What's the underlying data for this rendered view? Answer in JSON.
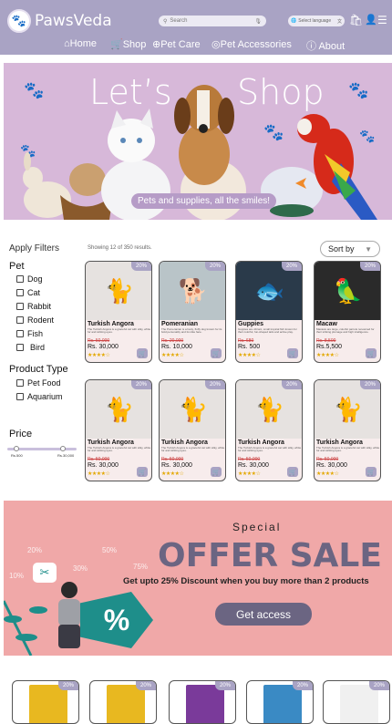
{
  "header": {
    "brand": "PawsVeda",
    "search_placeholder": "Search",
    "language_label": "Select language",
    "nav": [
      "Home",
      "Shop",
      "Pet Care",
      "Pet Accessories",
      "About"
    ]
  },
  "hero": {
    "title_left": "Let’s",
    "title_right": "Shop",
    "subtitle": "Pets and supplies, all the smiles!"
  },
  "filters": {
    "heading": "Apply Filters",
    "pet_heading": "Pet",
    "pets": [
      "Dog",
      "Cat",
      "Rabbit",
      "Rodent",
      "Fish",
      "Bird"
    ],
    "product_type_heading": "Product Type",
    "product_types": [
      "Pet Food",
      "Aquarium"
    ],
    "price_heading": "Price",
    "price_min": "Rs.500",
    "price_max": "Rs.30,000"
  },
  "results": {
    "showing": "Showing 12 of 350 results.",
    "sort_label": "Sort by"
  },
  "products": [
    {
      "name": "Turkish Angora",
      "desc": "The Turkish Angora is a graceful cat with silky, white fur and striking eyes.",
      "old_price": "Rs. 50,000",
      "price": "Rs. 30,000",
      "discount": "20%",
      "stars": "★★★★☆"
    },
    {
      "name": "Pomeranian",
      "desc": "The Pomeranian is a lively, fluffy dog known for its bold personality and fox-like face.",
      "old_price": "Rs. 20,000",
      "price": "Rs. 10,000",
      "discount": "20%",
      "stars": "★★★★☆"
    },
    {
      "name": "Guppies",
      "desc": "Guppies are vibrant, small tropical fish known for their colorful, fun-shaped tails and active play.",
      "old_price": "Rs. 680",
      "price": "Rs. 500",
      "discount": "20%",
      "stars": "★★★★☆"
    },
    {
      "name": "Macaw",
      "desc": "Macaws are large, colorful parrots renowned for their striking plumage and high intelligence.",
      "old_price": "Rs. 8,500",
      "price": "Rs.5,500",
      "discount": "20%",
      "stars": "★★★★☆"
    },
    {
      "name": "Turkish Angora",
      "desc": "The Turkish Angora is a graceful cat with silky, white fur and striking eyes.",
      "old_price": "Rs. 50,000",
      "price": "Rs. 30,000",
      "discount": "20%",
      "stars": "★★★★☆"
    },
    {
      "name": "Turkish Angora",
      "desc": "The Turkish Angora is a graceful cat with silky, white fur and striking eyes.",
      "old_price": "Rs. 50,000",
      "price": "Rs. 30,000",
      "discount": "20%",
      "stars": "★★★★☆"
    },
    {
      "name": "Turkish Angora",
      "desc": "The Turkish Angora is a graceful cat with silky, white fur and striking eyes.",
      "old_price": "Rs. 50,000",
      "price": "Rs. 30,000",
      "discount": "20%",
      "stars": "★★★★☆"
    },
    {
      "name": "Turkish Angora",
      "desc": "The Turkish Angora is a graceful cat with silky, white fur and striking eyes.",
      "old_price": "Rs. 50,000",
      "price": "Rs. 30,000",
      "discount": "20%",
      "stars": "★★★★☆"
    }
  ],
  "offer": {
    "special": "Special",
    "title": "OFFER SALE",
    "subtitle": "Get upto 25% Discount when you buy more than 2 products",
    "button": "Get access",
    "percent_symbol": "%",
    "floating": [
      "20%",
      "50%",
      "30%",
      "75%",
      "10%"
    ]
  },
  "bottom_products": [
    {
      "discount": "20%"
    },
    {
      "discount": "20%"
    },
    {
      "discount": "20%"
    },
    {
      "discount": "20%"
    },
    {
      "discount": "20%"
    }
  ],
  "colors": {
    "header_bg": "#a9a3c4",
    "hero_bg": "#d7b8d9",
    "offer_bg": "#f0a8a8",
    "accent_dark": "#6b6582",
    "card_bg": "#f7ecec"
  }
}
